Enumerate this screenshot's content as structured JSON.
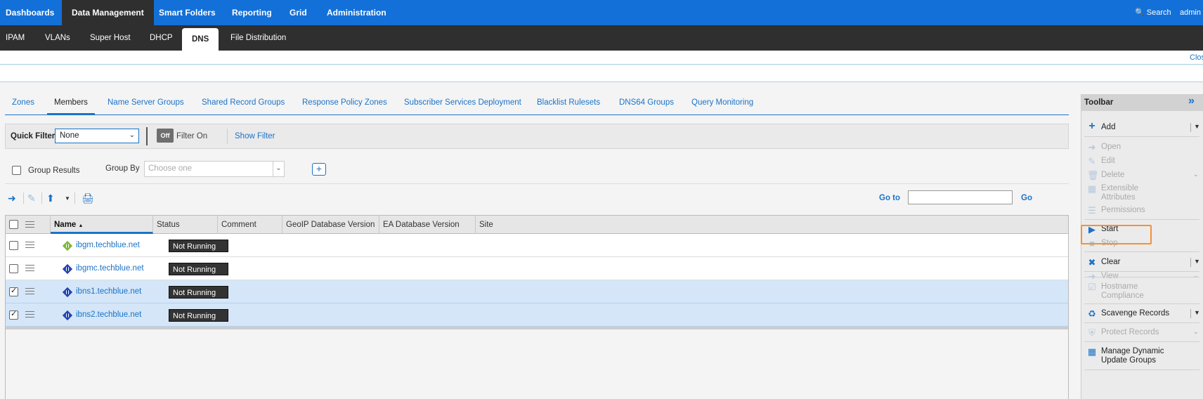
{
  "topnav": {
    "tabs": [
      "Dashboards",
      "Data Management",
      "Smart Folders",
      "Reporting",
      "Grid",
      "Administration"
    ],
    "search": "Search",
    "user": "admin"
  },
  "subnav": {
    "tabs": [
      "IPAM",
      "VLANs",
      "Super Host",
      "DHCP",
      "DNS",
      "File Distribution"
    ]
  },
  "strip": {
    "close_label": "Clos"
  },
  "dns_tabs": [
    "Zones",
    "Members",
    "Name Server Groups",
    "Shared Record Groups",
    "Response Policy Zones",
    "Subscriber Services Deployment",
    "Blacklist Rulesets",
    "DNS64 Groups",
    "Query Monitoring"
  ],
  "filter": {
    "label": "Quick Filter",
    "value": "None",
    "toggle": "Off",
    "filter_on": "Filter On",
    "show_filter": "Show Filter"
  },
  "group": {
    "group_results": "Group Results",
    "group_by": "Group By",
    "placeholder": "Choose one",
    "plus": "+"
  },
  "goto": {
    "label": "Go to",
    "button": "Go"
  },
  "grid": {
    "columns": [
      "Name",
      "Status",
      "Comment",
      "GeoIP Database Version",
      "EA Database Version",
      "Site"
    ],
    "sort_indicator": "▲",
    "rows": [
      {
        "name": "ibgm.techblue.net",
        "status": "Not Running",
        "checked": false,
        "icon_color": "#7ab534"
      },
      {
        "name": "ibgmc.techblue.net",
        "status": "Not Running",
        "checked": false,
        "icon_color": "#1f3fb0"
      },
      {
        "name": "ibns1.techblue.net",
        "status": "Not Running",
        "checked": true,
        "icon_color": "#1f3fb0"
      },
      {
        "name": "ibns2.techblue.net",
        "status": "Not Running",
        "checked": true,
        "icon_color": "#1f3fb0"
      }
    ]
  },
  "toolbar": {
    "title": "Toolbar",
    "items": [
      {
        "label": "Add",
        "enabled": true,
        "icon": "plus-icon",
        "dropdown": true
      },
      {
        "label": "Open",
        "enabled": false,
        "icon": "arrow-right-icon"
      },
      {
        "label": "Edit",
        "enabled": false,
        "icon": "edit-icon"
      },
      {
        "label": "Delete",
        "enabled": false,
        "icon": "trash-icon",
        "dropdown": true
      },
      {
        "label": "Extensible Attributes",
        "enabled": false,
        "icon": "list-icon"
      },
      {
        "label": "Permissions",
        "enabled": false,
        "icon": "permissions-icon"
      },
      {
        "label": "Start",
        "enabled": true,
        "icon": "play-icon"
      },
      {
        "label": "Stop",
        "enabled": false,
        "icon": "stop-icon"
      },
      {
        "label": "Clear",
        "enabled": true,
        "icon": "clear-icon",
        "dropdown": true
      },
      {
        "label": "View",
        "enabled": false,
        "icon": "arrow-right-icon",
        "dropdown": true
      },
      {
        "label": "Hostname Compliance",
        "enabled": false,
        "icon": "check-icon"
      },
      {
        "label": "Scavenge Records",
        "enabled": true,
        "icon": "recycle-icon",
        "dropdown": true
      },
      {
        "label": "Protect Records",
        "enabled": false,
        "icon": "shield-icon",
        "dropdown": true
      },
      {
        "label": "Manage Dynamic Update Groups",
        "enabled": true,
        "icon": "grid-icon"
      }
    ]
  },
  "colors": {
    "primary": "#1370d8",
    "dark": "#2f2f2f",
    "link": "#1a73c8",
    "highlight": "#f39233",
    "selected_row": "#d4e6f8"
  }
}
